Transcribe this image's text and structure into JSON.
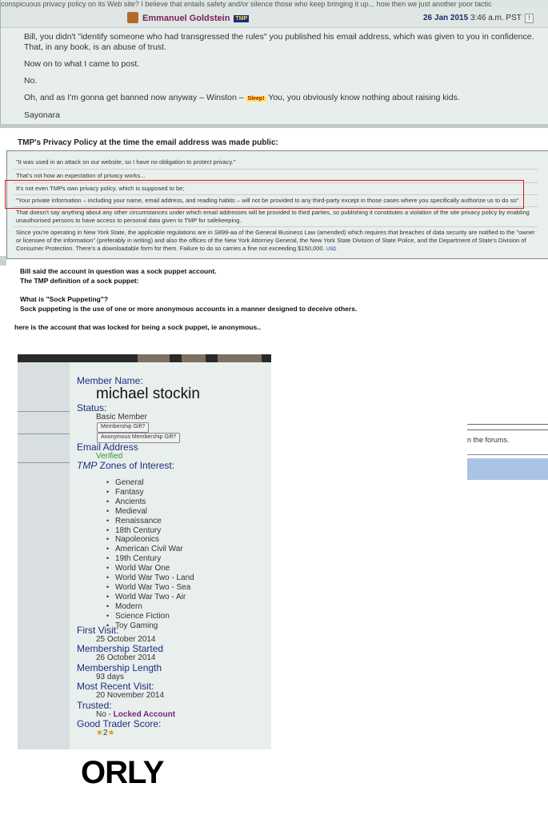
{
  "post": {
    "top_text": "conspicuous privacy policy on its Web site? I believe that entails safety and/or silence those who keep bringing it up... how then we just another poor tactic",
    "author": "Emmanuel Goldstein",
    "badge": "TMP",
    "date_bold": "26 Jan 2015",
    "date_rest": "3:46 a.m. PST",
    "flag": "!",
    "paragraphs": [
      "Bill, you didn't \"identify someone who had transgressed the rules\" you published his email address, which was given to you in confidence. That, in any book, is an abuse of trust.",
      "Now on to what I came to post.",
      "No.",
      "Sayonara"
    ],
    "last_para_before": "Oh, and as I'm gonna get banned now anyway – Winston –",
    "sleep_label": "Sleep!",
    "last_para_after": "You, you obviously know nothing about raising kids."
  },
  "policy_heading": "TMP's Privacy Policy at the time the email address was made public:",
  "quote": {
    "lines": [
      "\"It was used in an attack on our website, so I have no obligation to protect privacy.\"",
      "That's not how an expectation of privacy works...",
      "It's not even TMPs own privacy policy, which is supposed to be;",
      "\"Your private information – including your name, email address, and reading habits – will not be provided to any third-party except in those cases where you specifically authorize us to do so\"",
      "That doesn't say anything about any other circumstances under which email addresses will be provided to third parties, so publishing it constitutes a violation of the site privacy policy by enabling unauthorised persons to have access to personal data given to TMP for safekeeping.",
      "Since you're operating in New York State, the applicable regulations are in S899-aa of the General Business Law (amended) which requires that breaches of data security are notified to the \"owner or licensee of the information\" (preferably in writing) and also the offices of the New York Attorney General, the New York State Division of State Police, and the Department of State's Division of Consumer Protection. There's a downloadable form for them. Failure to do so carries a fine not exceeding $150,000."
    ],
    "usd": "USD"
  },
  "notes": {
    "line1": "Bill said the account in question was a sock puppet account.",
    "line2": "The TMP definition of a sock puppet:",
    "line3": "What is \"Sock Puppeting\"?",
    "line4": "Sock puppeting is the use of one or more anonymous accounts in a manner designed to deceive others.",
    "line5": "here is the account that was locked for being a sock puppet, ie anonymous.."
  },
  "profile": {
    "member_name_label": "Member Name:",
    "member_name": "michael stockin",
    "status_label": "Status:",
    "status": "Basic Member",
    "gift_button": "Membership Gift?",
    "anon_gift_button": "Anonymous Membership Gift?",
    "email_label": "Email Address",
    "email_status": "Verified",
    "zones_label_italic": "TMP",
    "zones_label_rest": " Zones of Interest:",
    "zones": [
      "General",
      "Fantasy",
      "Ancients",
      "Medieval",
      "Renaissance",
      "18th Century",
      "Napoleonics",
      "American Civil War",
      "19th Century",
      "World War One",
      "World War Two - Land",
      "World War Two - Sea",
      "World War Two - Air",
      "Modern",
      "Science Fiction",
      "Toy Gaming"
    ],
    "first_visit_label": "First Visit:",
    "first_visit": "25 October 2014",
    "membership_started_label": "Membership Started",
    "membership_started": "26 October 2014",
    "membership_length_label": "Membership Length",
    "membership_length": "93 days",
    "recent_visit_label": "Most Recent Visit:",
    "recent_visit": "20 November 2014",
    "trusted_label": "Trusted:",
    "trusted_no": "No - ",
    "trusted_locked": "Locked Account",
    "trader_label": "Good Trader Score:",
    "trader_score": "2",
    "star_color": "#d4a017",
    "locked_color": "#7a1f7a"
  },
  "right_fragment_text": "n the forums.",
  "orly": "ORLY"
}
